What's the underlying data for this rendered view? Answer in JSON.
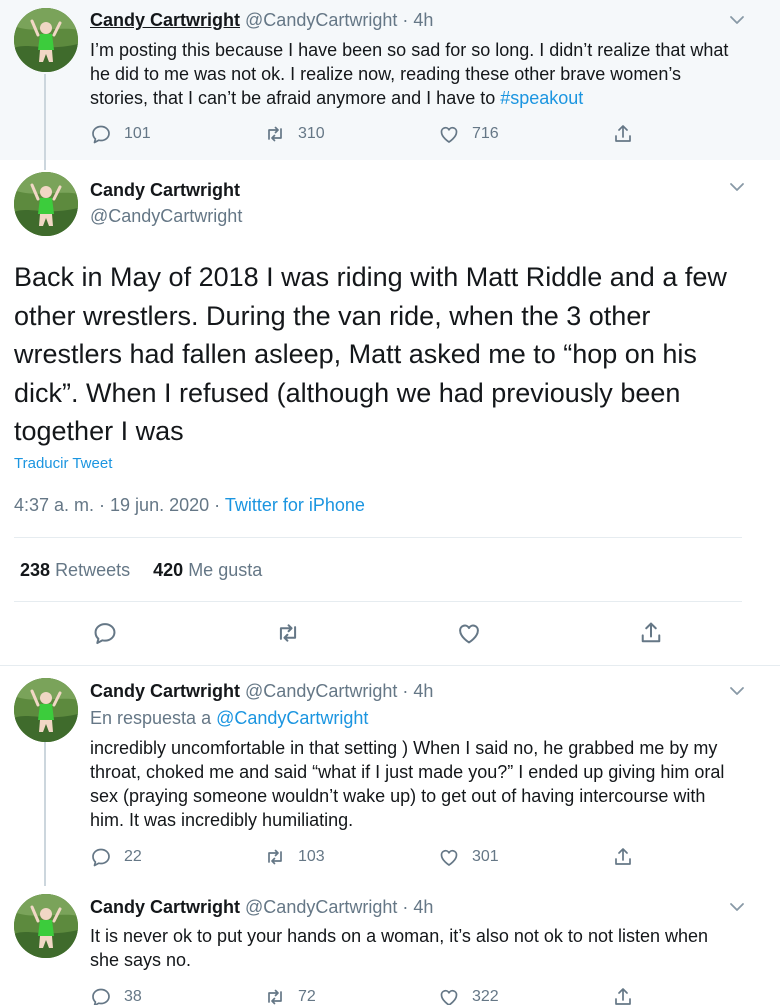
{
  "author": {
    "name": "Candy Cartwright",
    "handle": "@CandyCartwright"
  },
  "tweet1": {
    "time": "4h",
    "text_main": "I’m posting this because I have been so sad for so long. I didn’t realize that what he did to me was not ok. I realize now, reading these other brave women’s stories, that I can’t be afraid anymore and I have to ",
    "hashtag": "#speakout",
    "replies": "101",
    "retweets": "310",
    "likes": "716"
  },
  "main_tweet": {
    "text": "Back in May of 2018 I was riding with Matt Riddle and a few other wrestlers. During the van ride, when the 3 other wrestlers had fallen asleep, Matt asked me to “hop on his dick”. When I refused (although we had previously been together I was",
    "translate_label": "Traducir Tweet",
    "timestamp": "4:37 a. m. · 19 jun. 2020",
    "source": "Twitter for iPhone",
    "retweet_count": "238",
    "retweet_label": "Retweets",
    "like_count": "420",
    "like_label": "Me gusta"
  },
  "tweet3": {
    "time": "4h",
    "reply_prefix": "En respuesta a ",
    "reply_to": "@CandyCartwright",
    "text": "incredibly uncomfortable in that setting ) When I said no, he grabbed me by my throat, choked me and said “what if I just made you?” I ended up giving him oral sex (praying someone wouldn’t wake up) to get out of having intercourse with him. It was incredibly humiliating.",
    "replies": "22",
    "retweets": "103",
    "likes": "301"
  },
  "tweet4": {
    "time": "4h",
    "text": "It is never ok to put your hands on a woman, it’s also not ok to not listen when she says no.",
    "replies": "38",
    "retweets": "72",
    "likes": "322"
  },
  "colors": {
    "link": "#1b95e0",
    "muted": "#657786",
    "highlight_bg": "#f5f8fa"
  }
}
